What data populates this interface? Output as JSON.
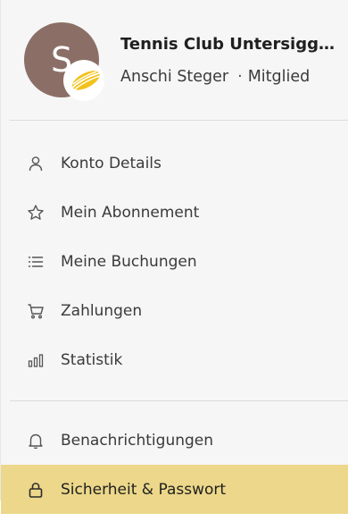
{
  "profile": {
    "avatar_letter": "S",
    "org_name": "Tennis Club Untersigg...",
    "user_name": "Anschi Steger",
    "separator": "·",
    "role": "Mitglied"
  },
  "menu": {
    "items": [
      {
        "label": "Konto Details",
        "icon": "person-icon"
      },
      {
        "label": "Mein Abonnement",
        "icon": "star-icon"
      },
      {
        "label": "Meine Buchungen",
        "icon": "list-icon"
      },
      {
        "label": "Zahlungen",
        "icon": "cart-icon"
      },
      {
        "label": "Statistik",
        "icon": "bar-chart-icon"
      }
    ],
    "items2": [
      {
        "label": "Benachrichtigungen",
        "icon": "bell-icon"
      },
      {
        "label": "Sicherheit & Passwort",
        "icon": "lock-icon",
        "active": true
      }
    ]
  },
  "colors": {
    "active_bg": "#ecd78a",
    "avatar_bg": "#8b6f66",
    "ball_yellow": "#f2c21b"
  }
}
